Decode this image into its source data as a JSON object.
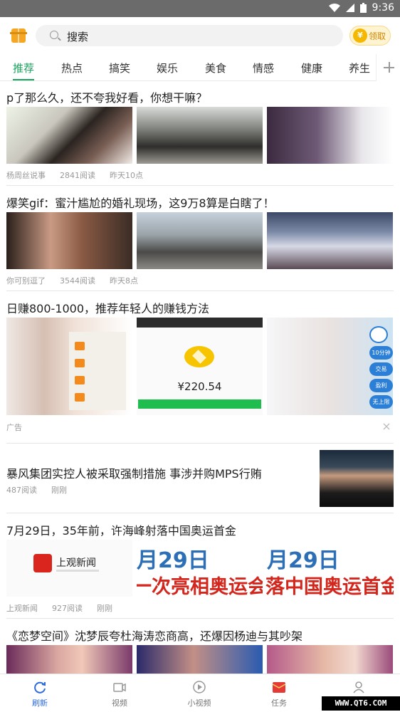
{
  "status": {
    "time": "9:36"
  },
  "header": {
    "search_placeholder": "搜索",
    "claim_label": "领取",
    "coin_symbol": "¥"
  },
  "tabs": [
    "推荐",
    "热点",
    "搞笑",
    "娱乐",
    "美食",
    "情感",
    "健康",
    "养生"
  ],
  "articles": [
    {
      "title": "p了那么久，还不夸我好看，你想干嘛？",
      "source": "杨周丝说事",
      "reads": "2841阅读",
      "time": "昨天10点"
    },
    {
      "title": "爆笑gif：蜜汁尴尬的婚礼现场，这9万8算是白瞎了！",
      "source": "你可别逗了",
      "reads": "3544阅读",
      "time": "昨天8点"
    },
    {
      "title": "日赚800-1000，推荐年轻人的赚钱方法",
      "ad_label": "广告",
      "ad_amount": "¥220.54",
      "ad_side": [
        "10分钟",
        "交易",
        "盈利",
        "无上限"
      ]
    },
    {
      "title": "暴风集团实控人被采取强制措施 事涉并购MPS行贿",
      "reads": "487阅读",
      "time": "刚刚"
    },
    {
      "title": "7月29日，35年前，许海峰射落中国奥运首金",
      "source": "上观新闻",
      "reads": "927阅读",
      "time": "刚刚",
      "banner_logo": "上观新闻",
      "banner_text1": "月29日",
      "banner_text2": "一次亮相奥运会",
      "banner_text3": "落中国奥运首金"
    },
    {
      "title": "《恋梦空间》沈梦辰夸杜海涛恋商高，还爆因杨迪与其吵架"
    }
  ],
  "bottom_nav": [
    "刷新",
    "视频",
    "小视频",
    "任务",
    "我的"
  ],
  "watermark": "WWW.QT6.COM",
  "colors": {
    "accent": "#1aa35d",
    "nav_active": "#2d6bdc",
    "task_red": "#e53935"
  }
}
